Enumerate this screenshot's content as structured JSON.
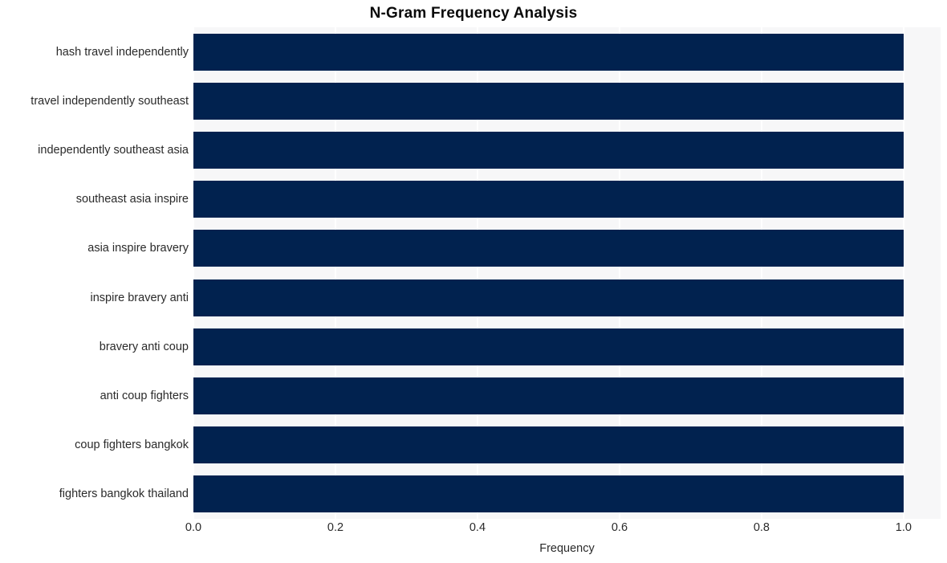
{
  "chart_data": {
    "type": "bar",
    "orientation": "horizontal",
    "title": "N-Gram Frequency Analysis",
    "xlabel": "Frequency",
    "ylabel": "",
    "categories": [
      "hash travel independently",
      "travel independently southeast",
      "independently southeast asia",
      "southeast asia inspire",
      "asia inspire bravery",
      "inspire bravery anti",
      "bravery anti coup",
      "anti coup fighters",
      "coup fighters bangkok",
      "fighters bangkok thailand"
    ],
    "values": [
      1.0,
      1.0,
      1.0,
      1.0,
      1.0,
      1.0,
      1.0,
      1.0,
      1.0,
      1.0
    ],
    "xticks": [
      "0.0",
      "0.2",
      "0.4",
      "0.6",
      "0.8",
      "1.0"
    ],
    "xtick_values": [
      0.0,
      0.2,
      0.4,
      0.6,
      0.8,
      1.0
    ],
    "xlim": [
      0.0,
      1.0521
    ],
    "grid": "vertical",
    "legend": null,
    "bar_color": "#01224f",
    "plot_background": "#f7f7f8",
    "figure_background": "#ffffff",
    "gridline_color": "#ffffff",
    "text_color": "#2a2a2a",
    "title_color": "#0a0a0a"
  }
}
